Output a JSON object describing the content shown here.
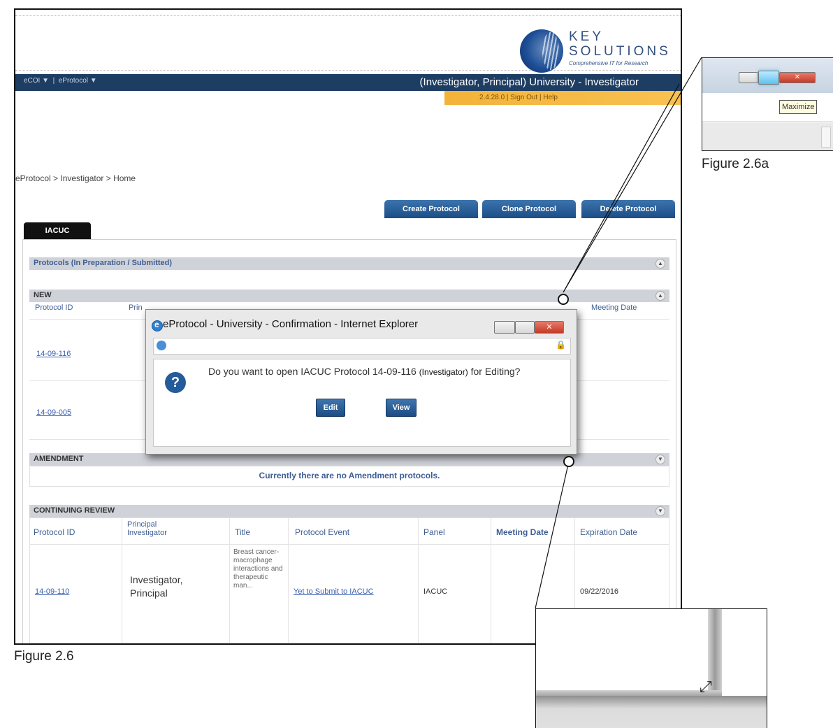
{
  "app": {
    "logo": {
      "line1": "KEY",
      "line2": "SOLUTIONS",
      "tagline": "Comprehensive IT for Research"
    },
    "nav": {
      "menu1": "eCOI",
      "menu2": "eProtocol",
      "user": "(Investigator, Principal) University - Investigator"
    },
    "version_bar": "2.4.28.0 | Sign Out | Help",
    "breadcrumb": "eProtocol > Investigator > Home",
    "buttons": {
      "create": "Create Protocol",
      "clone": "Clone Protocol",
      "delete": "Delete Protocol"
    },
    "tab": "IACUC",
    "section_title": "Protocols (In Preparation / Submitted)",
    "new_section": {
      "label": "NEW",
      "columns": {
        "protocol_id": "Protocol ID",
        "pi": "Principal Investigator",
        "meeting_date": "Meeting Date"
      },
      "rows": [
        "14-09-116",
        "14-09-005"
      ]
    },
    "amendment": {
      "label": "AMENDMENT",
      "empty": "Currently there are no Amendment protocols."
    },
    "continuing": {
      "label": "CONTINUING REVIEW",
      "columns": [
        "Protocol ID",
        "Principal Investigator",
        "Title",
        "Protocol Event",
        "Panel",
        "Meeting Date",
        "Expiration Date"
      ],
      "row": {
        "id": "14-09-110",
        "pi": "Investigator, Principal",
        "title": "Breast cancer-macrophage interactions and therapeutic man...",
        "event": "Yet to Submit to IACUC",
        "panel": "IACUC",
        "meeting": "",
        "expiration": "09/22/2016"
      }
    }
  },
  "dialog": {
    "title": "eProtocol - University - Confirmation - Internet Explorer",
    "message_prefix": "Do you want to open IACUC Protocol 14-09-116",
    "message_role": "(Investigator)",
    "message_suffix": "for Editing?",
    "edit": "Edit",
    "view": "View"
  },
  "inset_maximize": {
    "tooltip": "Maximize",
    "caption": "Figure 2.6a"
  },
  "caption_main": "Figure 2.6",
  "colors": {
    "navbar": "#1d3d63",
    "accent_orange": "#f3b33a",
    "button_blue": "#1c4d86"
  }
}
